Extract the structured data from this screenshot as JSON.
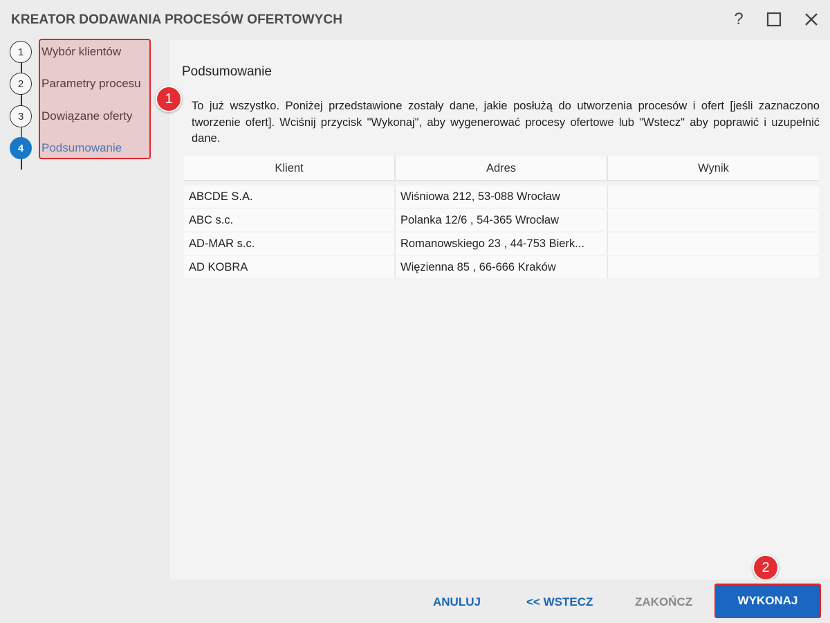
{
  "window": {
    "title": "KREATOR DODAWANIA PROCESÓW OFERTOWYCH",
    "help_glyph": "?"
  },
  "steps": [
    {
      "num": "1",
      "label": "Wybór klientów",
      "active": false
    },
    {
      "num": "2",
      "label": "Parametry procesu",
      "active": false
    },
    {
      "num": "3",
      "label": "Dowiązane oferty",
      "active": false
    },
    {
      "num": "4",
      "label": "Podsumowanie",
      "active": true
    }
  ],
  "main": {
    "section_title": "Podsumowanie",
    "description": "To już wszystko. Poniżej przedstawione zostały dane, jakie posłużą do utworzenia procesów i ofert [jeśli zaznaczono tworzenie ofert]. Wciśnij przycisk \"Wykonaj\", aby wygenerować procesy ofertowe lub \"Wstecz\" aby poprawić i uzupełnić dane."
  },
  "table": {
    "columns": [
      "Klient",
      "Adres",
      "Wynik"
    ],
    "rows": [
      [
        "ABCDE S.A.",
        "Wiśniowa 212, 53-088 Wrocław",
        ""
      ],
      [
        "ABC s.c.",
        "Polanka  12/6 , 54-365 Wrocław",
        ""
      ],
      [
        "AD-MAR s.c.",
        "Romanowskiego 23 , 44-753 Bierk...",
        ""
      ],
      [
        "AD KOBRA",
        "Więzienna  85 , 66-666 Kraków",
        ""
      ]
    ]
  },
  "footer": {
    "cancel": "ANULUJ",
    "back": "<< WSTECZ",
    "finish": "ZAKOŃCZ",
    "execute": "WYKONAJ"
  },
  "annotations": {
    "badge1": "1",
    "badge2": "2"
  },
  "colors": {
    "accent": "#1a78c8",
    "button": "#1a66c0",
    "annotation": "#e42d32"
  },
  "icons": {
    "help": "help-icon",
    "maximize": "maximize-icon",
    "close": "close-icon"
  }
}
